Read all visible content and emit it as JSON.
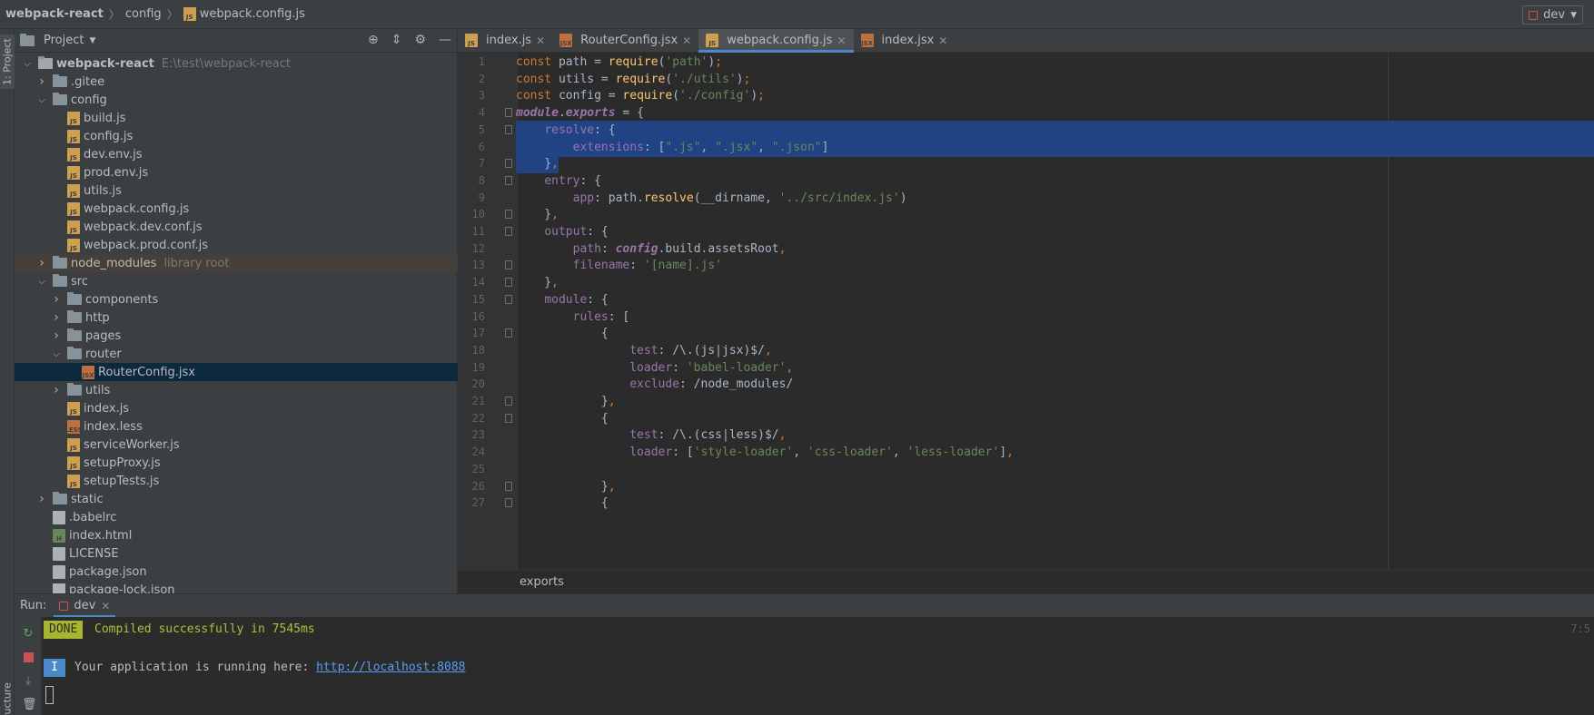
{
  "navbar": {
    "crumbs": [
      "webpack-react",
      "config",
      "webpack.config.js"
    ],
    "run_config": "dev"
  },
  "left_strip": {
    "project_label": "1: Project",
    "structure_label": "Z: Structure"
  },
  "project_pane": {
    "title": "Project",
    "tree": [
      {
        "label": "webpack-react",
        "extra": "E:\\test\\webpack-react",
        "kind": "proj",
        "depth": 0,
        "arrow": "open"
      },
      {
        "label": ".gitee",
        "kind": "folder",
        "depth": 1,
        "arrow": "closed"
      },
      {
        "label": "config",
        "kind": "folder",
        "depth": 1,
        "arrow": "open"
      },
      {
        "label": "build.js",
        "kind": "js",
        "depth": 2
      },
      {
        "label": "config.js",
        "kind": "js",
        "depth": 2
      },
      {
        "label": "dev.env.js",
        "kind": "js",
        "depth": 2
      },
      {
        "label": "prod.env.js",
        "kind": "js",
        "depth": 2
      },
      {
        "label": "utils.js",
        "kind": "js",
        "depth": 2
      },
      {
        "label": "webpack.config.js",
        "kind": "js",
        "depth": 2
      },
      {
        "label": "webpack.dev.conf.js",
        "kind": "js",
        "depth": 2
      },
      {
        "label": "webpack.prod.conf.js",
        "kind": "js",
        "depth": 2
      },
      {
        "label": "node_modules",
        "extra": "library root",
        "kind": "folder",
        "depth": 1,
        "arrow": "closed",
        "hl": "lib"
      },
      {
        "label": "src",
        "kind": "folder",
        "depth": 1,
        "arrow": "open"
      },
      {
        "label": "components",
        "kind": "folder",
        "depth": 2,
        "arrow": "closed"
      },
      {
        "label": "http",
        "kind": "folder",
        "depth": 2,
        "arrow": "closed"
      },
      {
        "label": "pages",
        "kind": "folder",
        "depth": 2,
        "arrow": "closed"
      },
      {
        "label": "router",
        "kind": "folder",
        "depth": 2,
        "arrow": "open"
      },
      {
        "label": "RouterConfig.jsx",
        "kind": "jsx",
        "depth": 3,
        "hl": "sel"
      },
      {
        "label": "utils",
        "kind": "folder",
        "depth": 2,
        "arrow": "closed"
      },
      {
        "label": "index.js",
        "kind": "js",
        "depth": 2
      },
      {
        "label": "index.less",
        "kind": "less",
        "depth": 2
      },
      {
        "label": "serviceWorker.js",
        "kind": "js",
        "depth": 2
      },
      {
        "label": "setupProxy.js",
        "kind": "js",
        "depth": 2
      },
      {
        "label": "setupTests.js",
        "kind": "js",
        "depth": 2
      },
      {
        "label": "static",
        "kind": "folder",
        "depth": 1,
        "arrow": "closed"
      },
      {
        "label": ".babelrc",
        "kind": "gen",
        "depth": 1
      },
      {
        "label": "index.html",
        "kind": "html",
        "depth": 1
      },
      {
        "label": "LICENSE",
        "kind": "gen",
        "depth": 1
      },
      {
        "label": "package.json",
        "kind": "gen",
        "depth": 1
      },
      {
        "label": "package-lock.json",
        "kind": "gen",
        "depth": 1
      }
    ]
  },
  "tabs": [
    {
      "label": "index.js",
      "kind": "js",
      "active": false
    },
    {
      "label": "RouterConfig.jsx",
      "kind": "jsx",
      "active": false
    },
    {
      "label": "webpack.config.js",
      "kind": "js",
      "active": true
    },
    {
      "label": "index.jsx",
      "kind": "jsx",
      "active": false
    }
  ],
  "code_lines": [
    "const path = require('path');",
    "const utils = require('./utils');",
    "const config = require('./config');",
    "module.exports = {",
    "    resolve: {",
    "        extensions: [\".js\", \".jsx\", \".json\"]",
    "    },",
    "    entry: {",
    "        app: path.resolve(__dirname, '../src/index.js')",
    "    },",
    "    output: {",
    "        path: config.build.assetsRoot,",
    "        filename: '[name].js'",
    "    },",
    "    module: {",
    "        rules: [",
    "            {",
    "                test: /\\.(js|jsx)$/,",
    "                loader: 'babel-loader',",
    "                exclude: /node_modules/",
    "            },",
    "            {",
    "                test: /\\.(css|less)$/,",
    "                loader: ['style-loader', 'css-loader', 'less-loader'],",
    "",
    "            },",
    "            {"
  ],
  "editor_breadcrumb": "exports",
  "run_panel": {
    "run_label": "Run:",
    "tab_label": "dev",
    "done_badge": "DONE",
    "done_message": "Compiled successfully in 7545ms",
    "info_badge": "I",
    "info_message": "Your application is running here: ",
    "info_url": "http://localhost:8088",
    "right_pos": "7:5"
  }
}
